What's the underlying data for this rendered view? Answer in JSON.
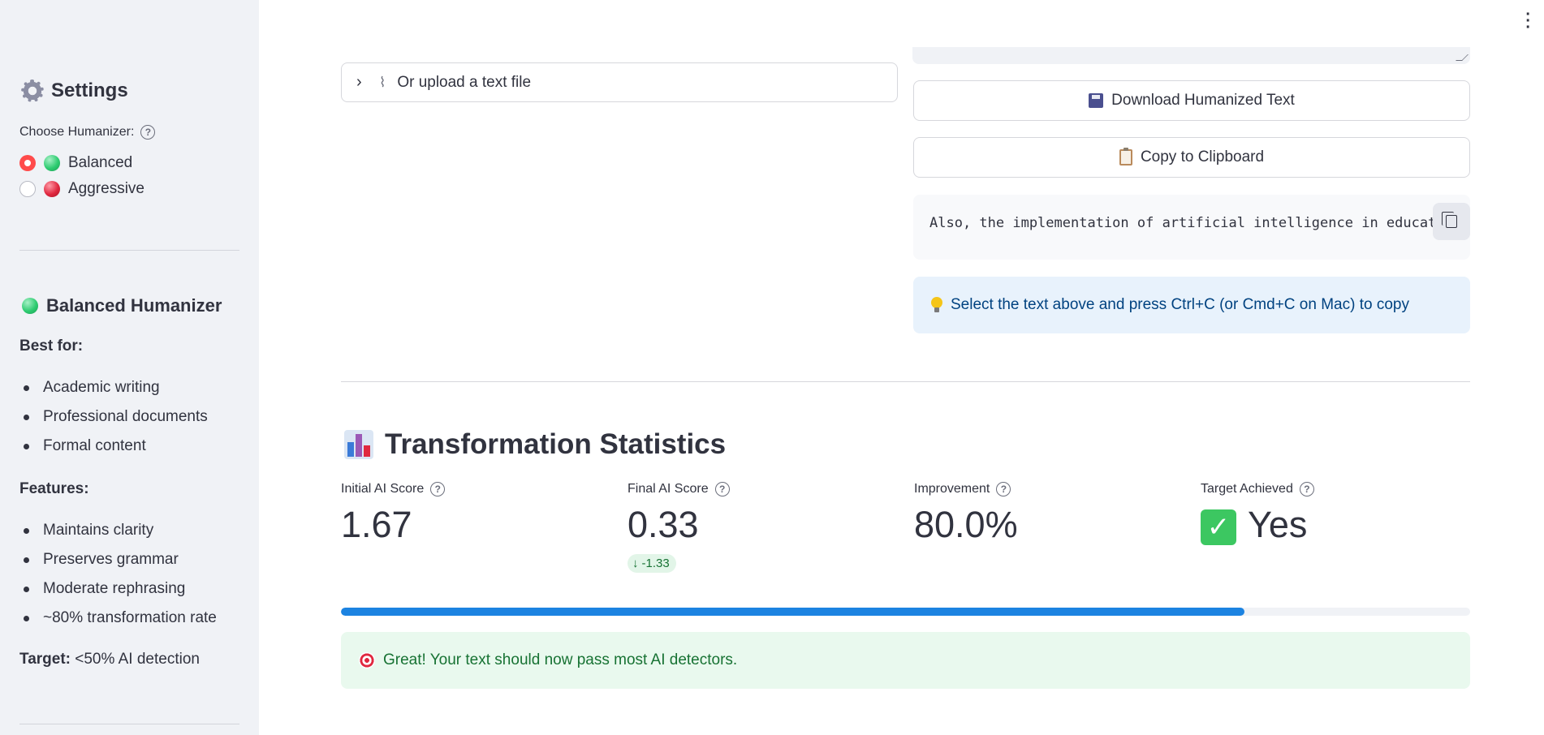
{
  "sidebar": {
    "title": "Settings",
    "choose_label": "Choose Humanizer:",
    "options": [
      {
        "label": "Balanced",
        "selected": true,
        "color": "#2ecc71"
      },
      {
        "label": "Aggressive",
        "selected": false,
        "color": "#e0283f"
      }
    ],
    "section_title": "Balanced Humanizer",
    "best_for_label": "Best for:",
    "best_for": [
      "Academic writing",
      "Professional documents",
      "Formal content"
    ],
    "features_label": "Features:",
    "features": [
      "Maintains clarity",
      "Preserves grammar",
      "Moderate rephrasing",
      "~80% transformation rate"
    ],
    "target_label": "Target:",
    "target_value": "<50% AI detection"
  },
  "main": {
    "upload_expander": "Or upload a text file",
    "download_button": "Download Humanized Text",
    "copy_button": "Copy to Clipboard",
    "code_text": "Also, the implementation of artificial intelligence in education",
    "info_text": "Select the text above and press Ctrl+C (or Cmd+C on Mac) to copy",
    "stats_title": "Transformation Statistics",
    "metrics": {
      "initial": {
        "label": "Initial AI Score",
        "value": "1.67"
      },
      "final": {
        "label": "Final AI Score",
        "value": "0.33",
        "delta": "-1.33"
      },
      "improvement": {
        "label": "Improvement",
        "value": "80.0%"
      },
      "target": {
        "label": "Target Achieved",
        "value": "Yes"
      }
    },
    "progress_fraction": 0.8,
    "success_text": "Great! Your text should now pass most AI detectors."
  },
  "colors": {
    "accent": "#ff4b4b",
    "progress": "#1c83e1",
    "info_bg": "#e8f2fc",
    "success_bg": "#e9f9ee"
  },
  "icons": {
    "settings": "gear-icon",
    "help": "question-circle-icon",
    "download": "floppy-disk-icon",
    "copy": "clipboard-icon",
    "info": "lightbulb-icon",
    "stats": "bar-chart-icon",
    "success": "target-icon",
    "check": "check-mark-icon"
  }
}
